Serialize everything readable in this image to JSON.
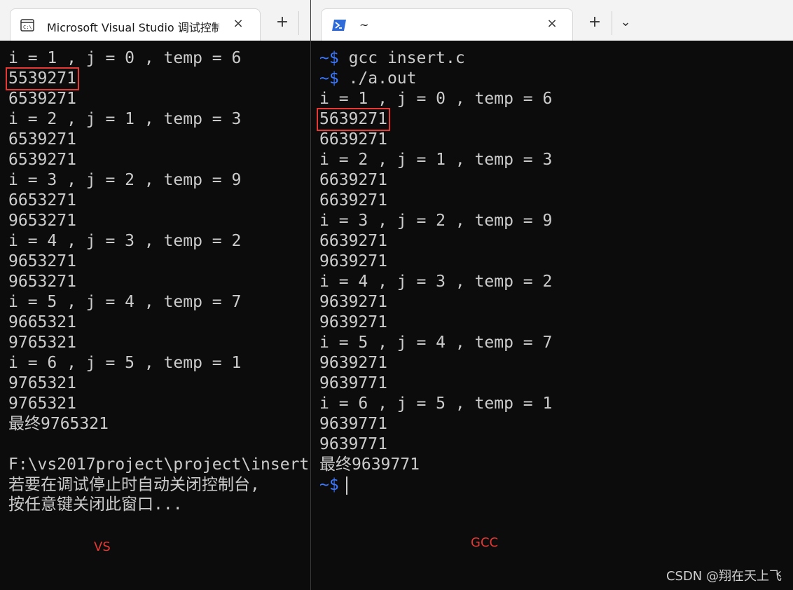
{
  "left_window": {
    "tab_title": "Microsoft Visual Studio 调试控制台",
    "new_tab_label": "+",
    "close_label": "×",
    "lines": [
      "i = 1 , j = 0 , temp = 6",
      "5539271",
      "6539271",
      "i = 2 , j = 1 , temp = 3",
      "6539271",
      "6539271",
      "i = 3 , j = 2 , temp = 9",
      "6653271",
      "9653271",
      "i = 4 , j = 3 , temp = 2",
      "9653271",
      "9653271",
      "i = 5 , j = 4 , temp = 7",
      "9665321",
      "9765321",
      "i = 6 , j = 5 , temp = 1",
      "9765321",
      "9765321",
      "最终9765321",
      "",
      "F:\\vs2017project\\project\\insert",
      "若要在调试停止时自动关闭控制台,",
      "按任意键关闭此窗口..."
    ],
    "highlighted_line_index": 1,
    "caption": "VS"
  },
  "right_window": {
    "tab_title": "~",
    "new_tab_label": "+",
    "dropdown_label": "⌄",
    "close_label": "×",
    "prompt": "~$",
    "commands": [
      "gcc insert.c",
      "./a.out"
    ],
    "lines": [
      "i = 1 , j = 0 , temp = 6",
      "5639271",
      "6639271",
      "i = 2 , j = 1 , temp = 3",
      "6639271",
      "6639271",
      "i = 3 , j = 2 , temp = 9",
      "6639271",
      "9639271",
      "i = 4 , j = 3 , temp = 2",
      "9639271",
      "9639271",
      "i = 5 , j = 4 , temp = 7",
      "9639271",
      "9639771",
      "i = 6 , j = 5 , temp = 1",
      "9639771",
      "9639771",
      "最终9639771"
    ],
    "highlighted_line_index": 1,
    "caption": "GCC"
  },
  "watermark": "CSDN @翔在天上飞",
  "colors": {
    "highlight_box": "#e53935",
    "prompt_tilde": "#3b78ff",
    "terminal_text": "#cccccc",
    "terminal_bg": "#0c0c0c"
  },
  "icons": {
    "left_tab_icon": "console-window-icon",
    "right_tab_icon": "powershell-icon"
  }
}
